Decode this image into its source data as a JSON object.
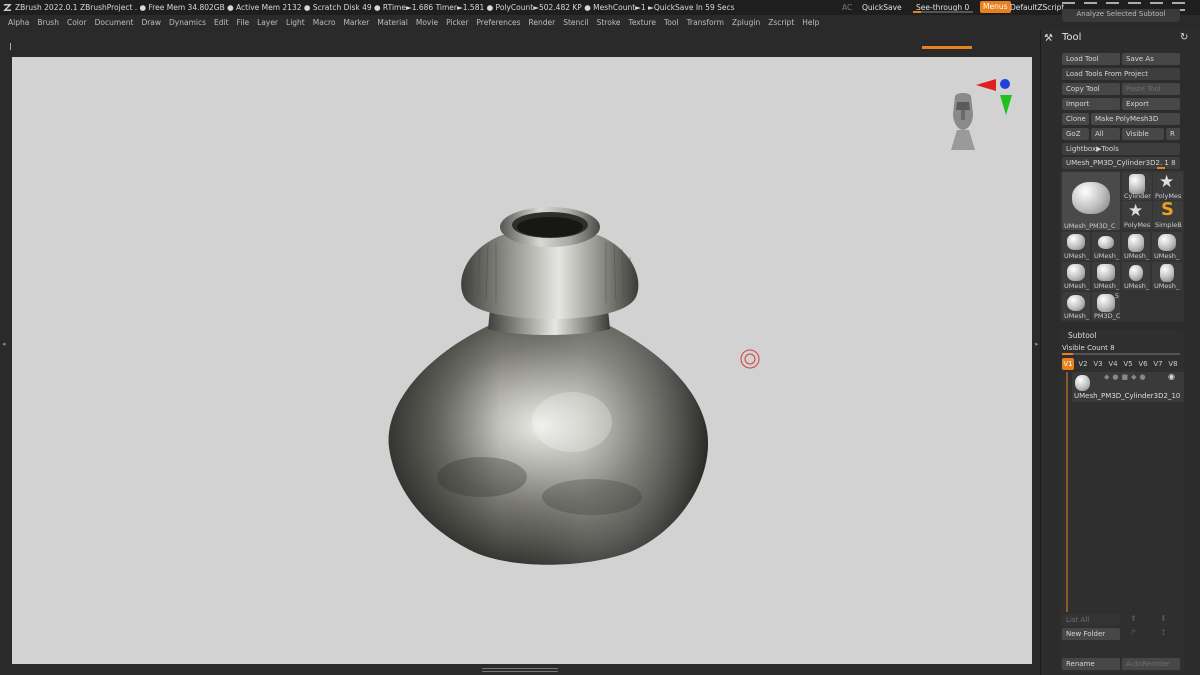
{
  "titlebar": {
    "stats": "ZBrush 2022.0.1    ZBrushProject   . ● Free Mem 34.802GB ● Active Mem 2132 ● Scratch Disk 49 ●  RTime►1.686 Timer►1.581 ● PolyCount►502.482 KP  ● MeshCount►1   ►QuickSave In 59 Secs",
    "ac": "AC",
    "quicksave": "QuickSave",
    "see_through": "See-through  0",
    "menus": "Menus",
    "default_zscript": "DefaultZScript"
  },
  "menubar": [
    "Alpha",
    "Brush",
    "Color",
    "Document",
    "Draw",
    "Dynamics",
    "Edit",
    "File",
    "Layer",
    "Light",
    "Macro",
    "Marker",
    "Material",
    "Movie",
    "Picker",
    "Preferences",
    "Render",
    "Stencil",
    "Stroke",
    "Texture",
    "Tool",
    "Transform",
    "Zplugin",
    "Zscript",
    "Help"
  ],
  "panel": {
    "top_strip": "Analyze Selected Subtool",
    "title": "Tool",
    "buttons": {
      "load_tool": "Load Tool",
      "save_as": "Save As",
      "load_tools_from_project": "Load Tools From Project",
      "copy_tool": "Copy Tool",
      "paste_tool": "Paste Tool",
      "import": "Import",
      "export": "Export",
      "clone": "Clone",
      "make_polymesh": "Make PolyMesh3D",
      "goz": "GoZ",
      "all": "All",
      "visible": "Visible",
      "r": "R",
      "lightbox_tools": "Lightbox▶Tools",
      "current_tool": "UMesh_PM3D_Cylinder3D2. 1 8"
    },
    "thumbs": {
      "main": "UMesh_PM3D_C",
      "cylinder": "Cylinder",
      "polymesh": "PolyMes",
      "polymesh2": "PolyMes",
      "simpleb": "SimpleB",
      "r1": [
        "UMesh_",
        "UMesh_",
        "UMesh_",
        "UMesh_"
      ],
      "r2": [
        "UMesh_",
        "UMesh_",
        "UMesh_",
        "UMesh_"
      ],
      "r3a": "UMesh_",
      "r3b": "PM3D_C",
      "r3b_num": "5"
    },
    "subtool": {
      "header": "Subtool",
      "visible_count": "Visible Count 8",
      "vtabs": [
        "V1",
        "V2",
        "V3",
        "V4",
        "V5",
        "V6",
        "V7",
        "V8"
      ],
      "item_name": "UMesh_PM3D_Cylinder3D2_10",
      "list_all": "List All",
      "new_folder": "New Folder",
      "rename": "Rename",
      "auto_reorder": "AutoReorder"
    }
  }
}
